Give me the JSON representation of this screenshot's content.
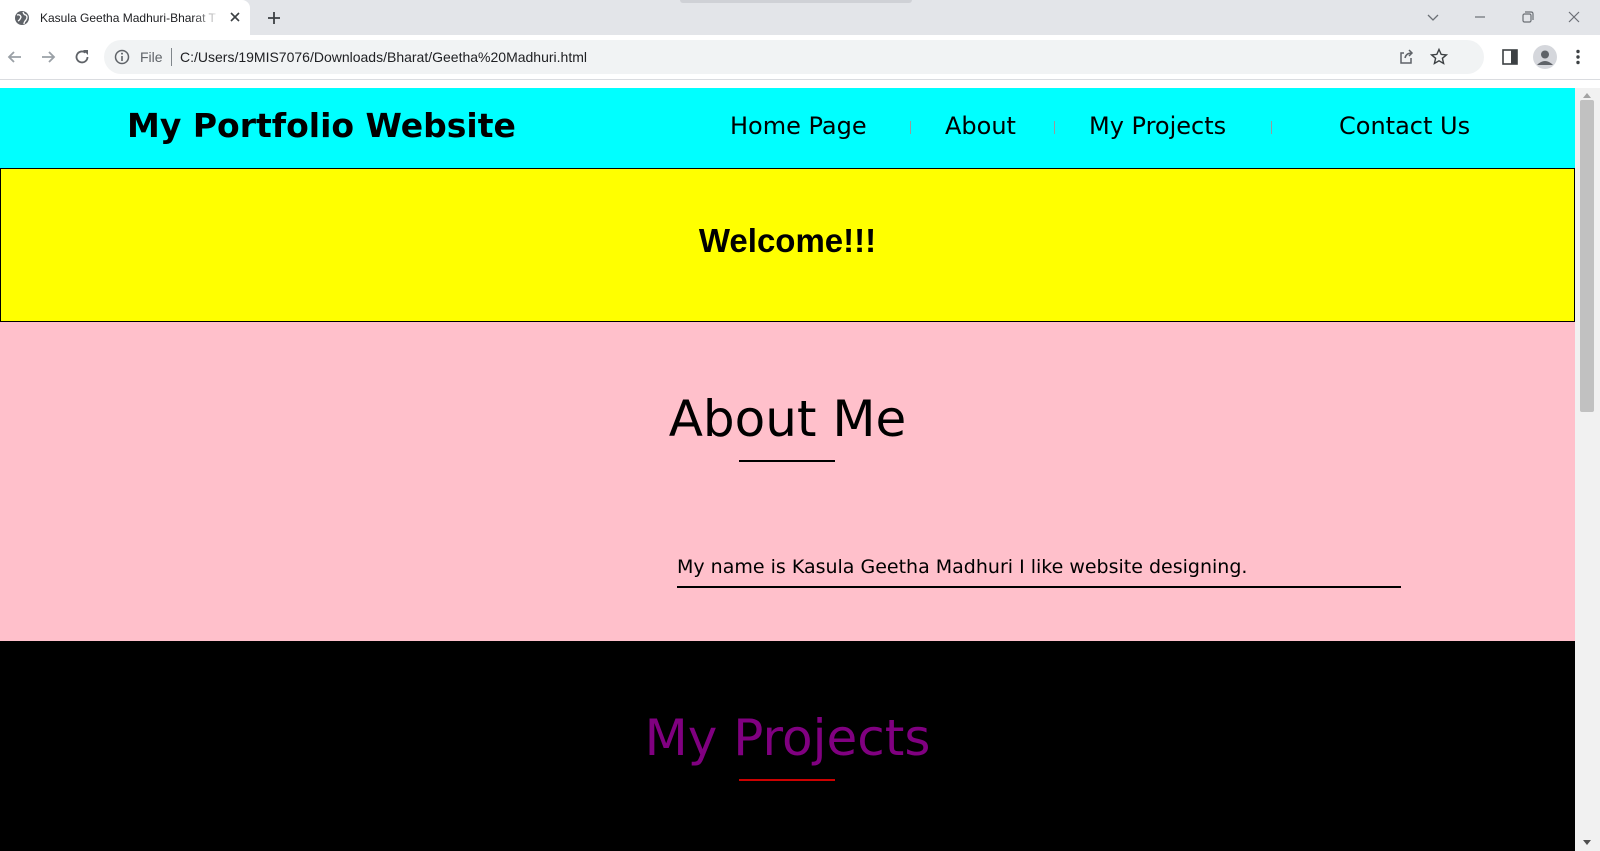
{
  "browser": {
    "tab_title": "Kasula Geetha Madhuri-Bharat T",
    "address_scheme": "File",
    "address_url": "C:/Users/19MIS7076/Downloads/Bharat/Geetha%20Madhuri.html"
  },
  "page": {
    "brand": "My Portfolio Website",
    "nav": [
      "Home Page",
      "About",
      "My Projects",
      "Contact Us"
    ],
    "welcome": "Welcome!!!",
    "about": {
      "heading": "About Me",
      "text": "My name is Kasula Geetha Madhuri I like website designing."
    },
    "projects": {
      "heading": "My Projects"
    }
  },
  "colors": {
    "nav_bg": "#00ffff",
    "welcome_bg": "#ffff00",
    "about_bg": "#ffc0cb",
    "projects_bg": "#000000",
    "projects_heading": "#800080",
    "projects_rule": "#cc0000"
  },
  "icons": [
    "globe-icon",
    "close-icon",
    "plus-icon",
    "chevron-down-icon",
    "minimize-icon",
    "restore-icon",
    "back-arrow-icon",
    "forward-arrow-icon",
    "reload-icon",
    "info-icon",
    "share-icon",
    "star-icon",
    "side-panel-icon",
    "profile-icon",
    "kebab-menu-icon"
  ]
}
